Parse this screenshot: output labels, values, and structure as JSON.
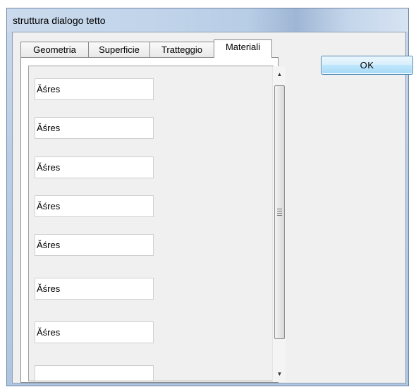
{
  "window": {
    "title": "struttura dialogo tetto"
  },
  "tabs": [
    {
      "label": "Geometria"
    },
    {
      "label": "Superficie"
    },
    {
      "label": "Tratteggio"
    },
    {
      "label": "Materiali",
      "active": true
    }
  ],
  "fields": [
    {
      "value": "Ǎśres"
    },
    {
      "value": "Ǎśres"
    },
    {
      "value": "Ǎśres"
    },
    {
      "value": "Ǎśres"
    },
    {
      "value": "Ǎśres"
    },
    {
      "value": "Ǎśres"
    },
    {
      "value": "Ǎśres"
    }
  ],
  "buttons": {
    "ok_label": "OK"
  },
  "scrollbar": {
    "up_glyph": "▲",
    "down_glyph": "▼"
  }
}
